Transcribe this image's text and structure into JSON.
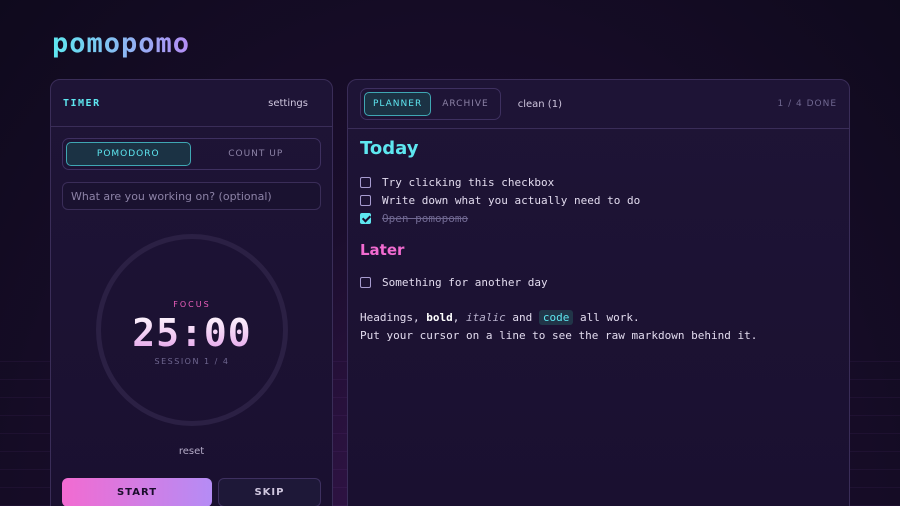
{
  "app": {
    "logo": "pomopomo"
  },
  "timer": {
    "title": "TIMER",
    "settings_label": "settings",
    "modes": [
      {
        "label": "POMODORO",
        "active": true
      },
      {
        "label": "COUNT UP",
        "active": false
      }
    ],
    "task_placeholder": "What are you working on? (optional)",
    "task_value": "",
    "phase_label": "FOCUS",
    "time": "25:00",
    "session_label": "SESSION 1 / 4",
    "reset_label": "reset",
    "start_label": "START",
    "skip_label": "SKIP"
  },
  "planner": {
    "tabs": [
      {
        "label": "PLANNER",
        "active": true
      },
      {
        "label": "ARCHIVE",
        "active": false
      }
    ],
    "clean_label": "clean (1)",
    "done_count": "1 / 4 DONE",
    "today_heading": "Today",
    "today_items": [
      {
        "text": "Try clicking this checkbox",
        "done": false
      },
      {
        "text": "Write down what you actually need to do",
        "done": false
      },
      {
        "text": "Open pomopomo",
        "done": true
      }
    ],
    "later_heading": "Later",
    "later_items": [
      {
        "text": "Something for another day",
        "done": false
      }
    ],
    "para1": {
      "pre": "Headings, ",
      "bold": "bold",
      "sep1": ", ",
      "italic": "italic",
      "sep2": " and ",
      "code": "code",
      "post": " all work."
    },
    "para2": "Put your cursor on a line to see the raw markdown behind it."
  },
  "colors": {
    "accent_cyan": "#5ee7f0",
    "accent_pink": "#f26bd1",
    "accent_violet": "#b58cf5",
    "background": "#150c25"
  }
}
